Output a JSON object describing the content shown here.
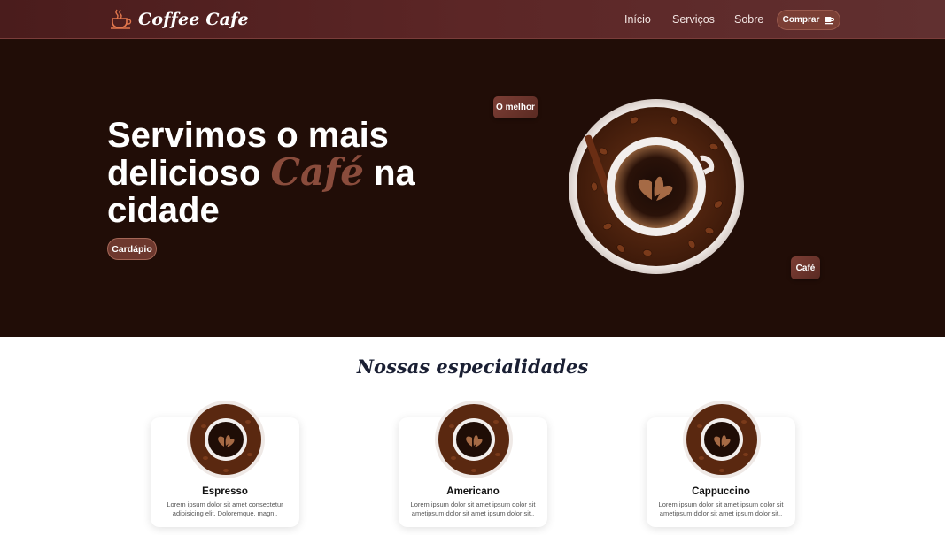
{
  "brand": {
    "name": "Coffee Cafe",
    "icon": "coffee-cup-icon"
  },
  "nav": {
    "links": [
      "Início",
      "Serviços",
      "Sobre"
    ],
    "buy_label": "Comprar",
    "buy_icon": "cup-icon"
  },
  "hero": {
    "title_before": "Servimos o mais delicioso",
    "title_accent": "Café",
    "title_after": "na cidade",
    "menu_button": "Cardápio",
    "badge_best": "O melhor",
    "badge_cafe": "Café"
  },
  "specialties": {
    "title": "Nossas especialidades",
    "items": [
      {
        "name": "Espresso",
        "desc": "Lorem ipsum dolor sit amet consectetur adipisicing elit. Doloremque, magni."
      },
      {
        "name": "Americano",
        "desc": "Lorem ipsum dolor sit amet ipsum dolor sit ametipsum dolor sit amet ipsum dolor sit.."
      },
      {
        "name": "Cappuccino",
        "desc": "Lorem ipsum dolor sit amet ipsum dolor sit ametipsum dolor sit amet ipsum dolor sit.."
      }
    ]
  },
  "colors": {
    "hero_bg": "#210d07",
    "accent": "#8a4c3c",
    "navbar": "#5c2626"
  }
}
